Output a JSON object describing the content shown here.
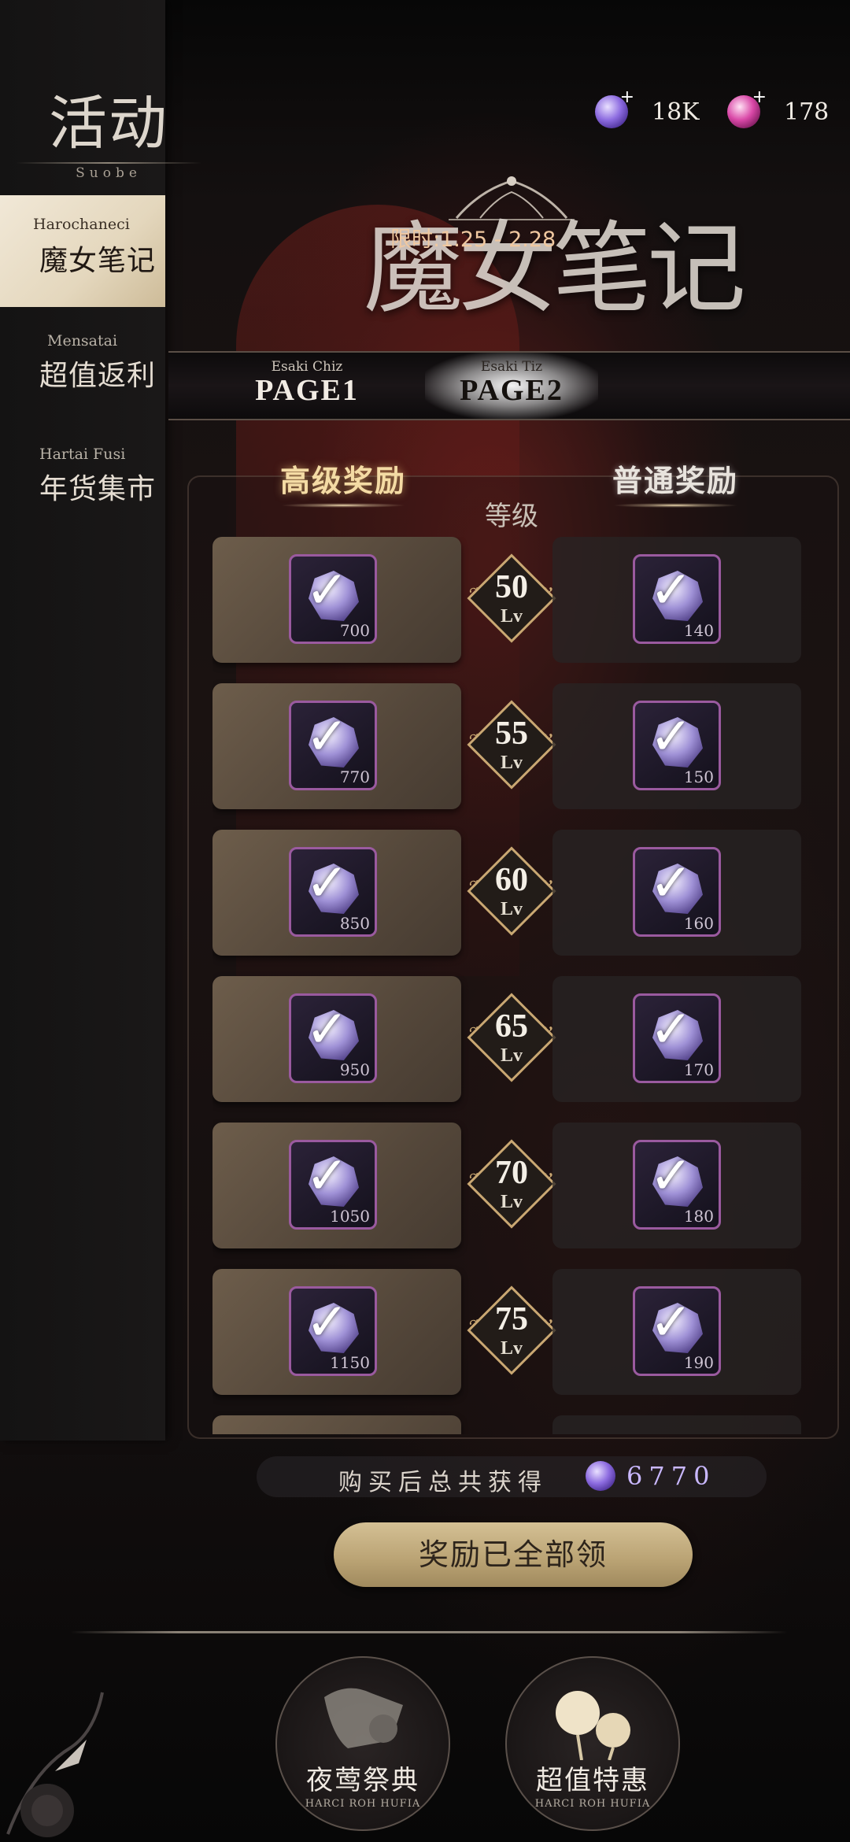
{
  "sidebar": {
    "title": "活动",
    "subtitle": "Suobe",
    "items": [
      {
        "en": "Harochaneci",
        "cn": "魔女笔记",
        "active": true
      },
      {
        "en": "Mensatai",
        "cn": "超值返利",
        "active": false
      },
      {
        "en": "Hartai Fusi",
        "cn": "年货集市",
        "active": false
      }
    ]
  },
  "currency": {
    "blue_gem": {
      "icon": "blue-gem-icon",
      "value": "18K"
    },
    "pink_gem": {
      "icon": "pink-gem-icon",
      "value": "178"
    }
  },
  "event": {
    "title": "魔女笔记",
    "time_limit": "限时:1.25 - 2.28"
  },
  "page_tabs": [
    {
      "en": "Esaki Chiz",
      "label": "PAGE1",
      "active": false
    },
    {
      "en": "Esaki Tiz",
      "label": "PAGE2",
      "active": true
    }
  ],
  "rewards": {
    "advanced_header": "高级奖励",
    "normal_header": "普通奖励",
    "level_header": "等级",
    "level_unit": "Lv",
    "rows": [
      {
        "level": "50",
        "advanced": "700",
        "normal": "140",
        "claimed": true
      },
      {
        "level": "55",
        "advanced": "770",
        "normal": "150",
        "claimed": true
      },
      {
        "level": "60",
        "advanced": "850",
        "normal": "160",
        "claimed": true
      },
      {
        "level": "65",
        "advanced": "950",
        "normal": "170",
        "claimed": true
      },
      {
        "level": "70",
        "advanced": "1050",
        "normal": "180",
        "claimed": true
      },
      {
        "level": "75",
        "advanced": "1150",
        "normal": "190",
        "claimed": true
      }
    ]
  },
  "footer": {
    "total_label": "购买后总共获得",
    "total_value": "6770",
    "claim_button": "奖励已全部领"
  },
  "bottom_nav": [
    {
      "cn": "夜莺祭典",
      "en": "HARCI ROH HUFIA",
      "icon": "scroll-icon"
    },
    {
      "cn": "超值特惠",
      "en": "HARCI ROH HUFIA",
      "icon": "rose-icon"
    }
  ],
  "colors": {
    "accent_gold": "#c9a772",
    "item_border": "#9a5a9f",
    "active_tab": "#f1e8d7"
  }
}
